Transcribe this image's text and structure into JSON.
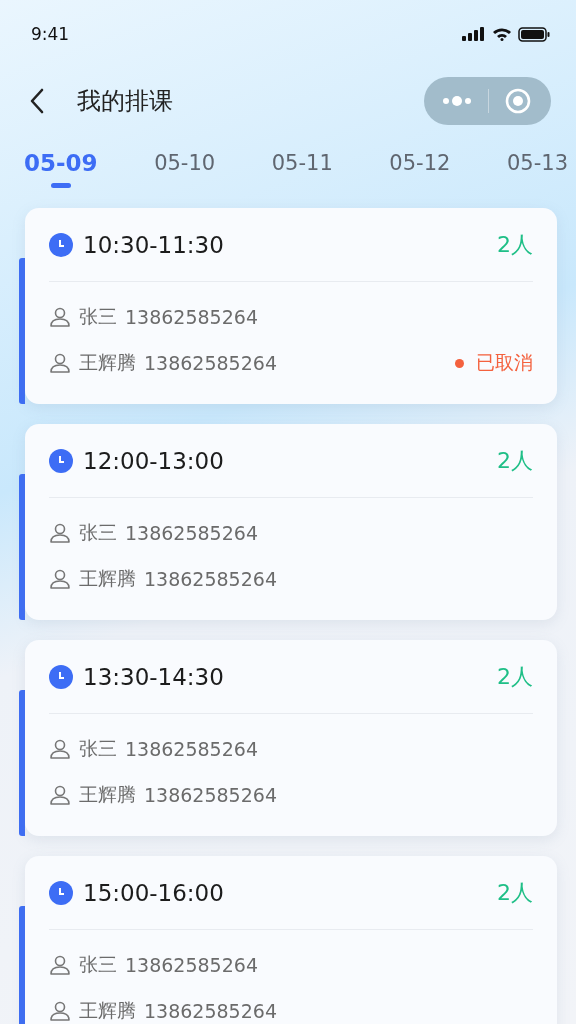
{
  "status_bar": {
    "time": "9:41"
  },
  "header": {
    "title": "我的排课"
  },
  "tabs": [
    {
      "label": "05-09",
      "selected": true
    },
    {
      "label": "05-10",
      "selected": false
    },
    {
      "label": "05-11",
      "selected": false
    },
    {
      "label": "05-12",
      "selected": false
    },
    {
      "label": "05-13",
      "selected": false
    }
  ],
  "sessions": [
    {
      "time": "10:30-11:30",
      "count": "2人",
      "people": [
        {
          "name": "张三",
          "phone": "13862585264"
        },
        {
          "name": "王辉腾",
          "phone": "13862585264",
          "status": "已取消"
        }
      ]
    },
    {
      "time": "12:00-13:00",
      "count": "2人",
      "people": [
        {
          "name": "张三",
          "phone": "13862585264"
        },
        {
          "name": "王辉腾",
          "phone": "13862585264"
        }
      ]
    },
    {
      "time": "13:30-14:30",
      "count": "2人",
      "people": [
        {
          "name": "张三",
          "phone": "13862585264"
        },
        {
          "name": "王辉腾",
          "phone": "13862585264"
        }
      ]
    },
    {
      "time": "15:00-16:00",
      "count": "2人",
      "people": [
        {
          "name": "张三",
          "phone": "13862585264"
        },
        {
          "name": "王辉腾",
          "phone": "13862585264"
        }
      ]
    }
  ]
}
